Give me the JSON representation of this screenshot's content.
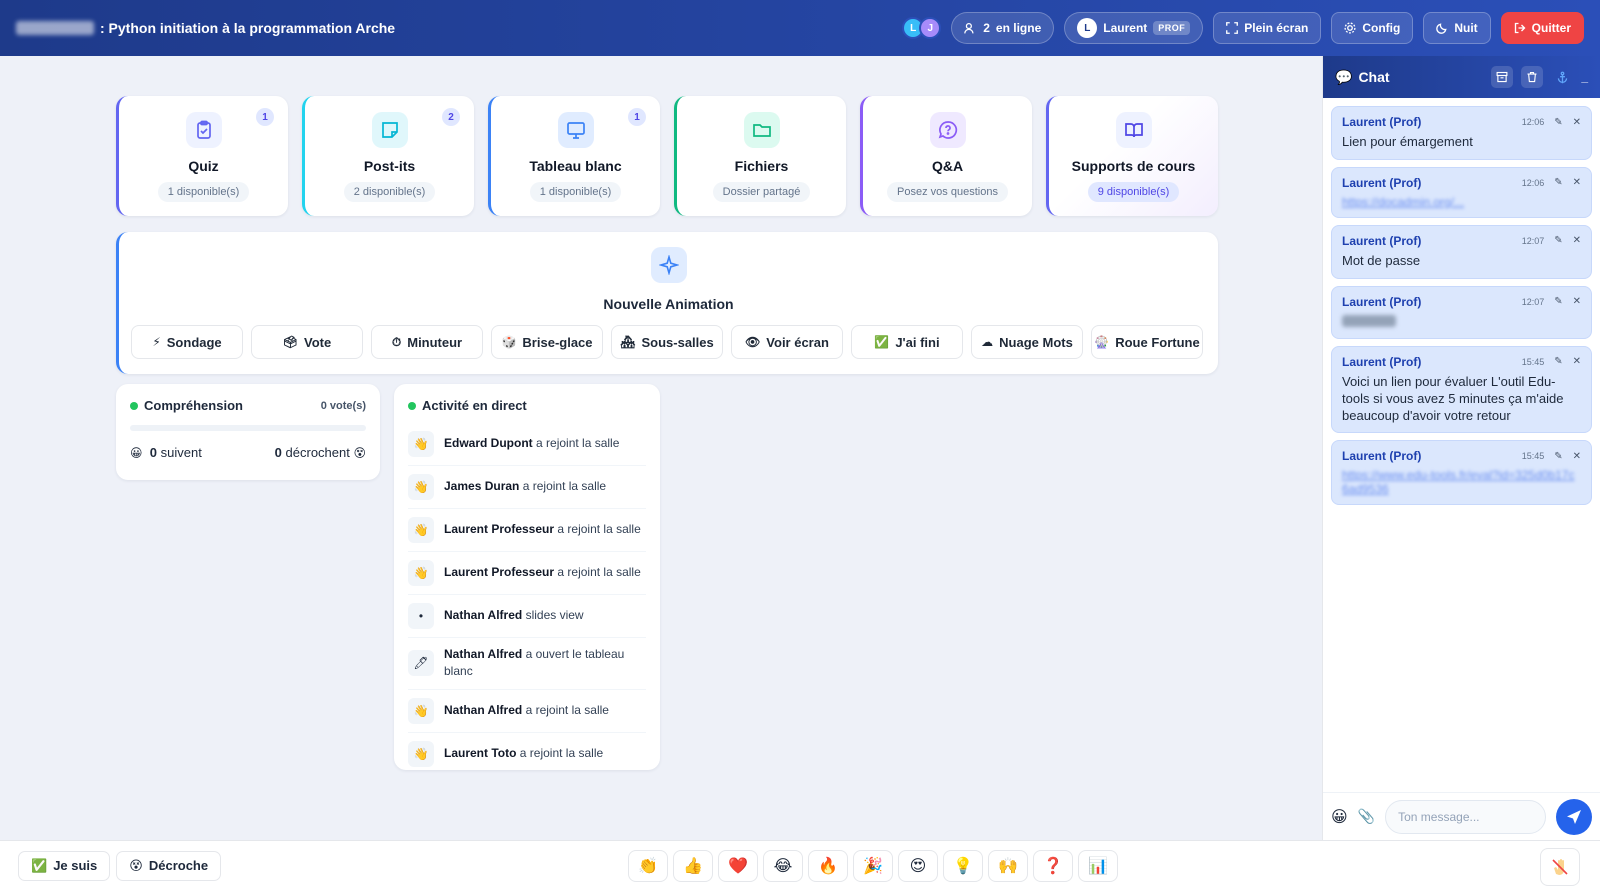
{
  "header": {
    "title": ": Python initiation à la programmation Arche",
    "avatars": [
      "L",
      "J"
    ],
    "online_count": "2",
    "online_label": "en ligne",
    "user_initial": "L",
    "user_name": "Laurent",
    "role_badge": "PROF",
    "fullscreen_label": "Plein écran",
    "config_label": "Config",
    "night_label": "Nuit",
    "quit_label": "Quitter"
  },
  "cards": [
    {
      "title": "Quiz",
      "sub": "1 disponible(s)",
      "count": "1"
    },
    {
      "title": "Post-its",
      "sub": "2 disponible(s)",
      "count": "2"
    },
    {
      "title": "Tableau blanc",
      "sub": "1 disponible(s)",
      "count": "1"
    },
    {
      "title": "Fichiers",
      "sub": "Dossier partagé"
    },
    {
      "title": "Q&A",
      "sub": "Posez vos questions"
    },
    {
      "title": "Supports de cours",
      "sub": "9 disponible(s)"
    }
  ],
  "animation": {
    "title": "Nouvelle Animation",
    "buttons": [
      {
        "icon": "⚡",
        "label": "Sondage"
      },
      {
        "icon": "🗳",
        "label": "Vote"
      },
      {
        "icon": "⏱",
        "label": "Minuteur"
      },
      {
        "icon": "🎲",
        "label": "Brise-glace"
      },
      {
        "icon": "🏘",
        "label": "Sous-salles"
      },
      {
        "icon": "👁",
        "label": "Voir écran"
      },
      {
        "icon": "✅",
        "label": "J'ai fini"
      },
      {
        "icon": "☁",
        "label": "Nuage Mots"
      },
      {
        "icon": "🎡",
        "label": "Roue Fortune"
      }
    ]
  },
  "comprehension": {
    "title": "Compréhension",
    "votes": "0 vote(s)",
    "follow_count": "0",
    "follow_label": "suivent",
    "drop_count": "0",
    "drop_label": "décrochent"
  },
  "activity": {
    "title": "Activité en direct",
    "items": [
      {
        "icon": "👋",
        "name": "Edward Dupont",
        "action": "a rejoint la salle"
      },
      {
        "icon": "👋",
        "name": "James Duran",
        "action": "a rejoint la salle"
      },
      {
        "icon": "👋",
        "name": "Laurent Professeur",
        "action": "a rejoint la salle"
      },
      {
        "icon": "👋",
        "name": "Laurent Professeur",
        "action": "a rejoint la salle"
      },
      {
        "icon": "•",
        "name": "Nathan Alfred",
        "action": "slides view"
      },
      {
        "icon": "🖊",
        "name": "Nathan Alfred",
        "action": "a ouvert le tableau blanc"
      },
      {
        "icon": "👋",
        "name": "Nathan Alfred",
        "action": "a rejoint la salle"
      },
      {
        "icon": "👋",
        "name": "Laurent Toto",
        "action": "a rejoint la salle"
      }
    ]
  },
  "chat": {
    "title": "Chat",
    "input_placeholder": "Ton message...",
    "messages": [
      {
        "author": "Laurent (Prof)",
        "time": "12:06",
        "body": "Lien pour émargement"
      },
      {
        "author": "Laurent (Prof)",
        "time": "12:06",
        "link": "https://docadmin.org/..."
      },
      {
        "author": "Laurent (Prof)",
        "time": "12:07",
        "body": "Mot de passe"
      },
      {
        "author": "Laurent (Prof)",
        "time": "12:07"
      },
      {
        "author": "Laurent (Prof)",
        "time": "15:45",
        "body": "Voici un lien pour évaluer L'outil Edu-tools si vous avez 5 minutes ça m'aide beaucoup d'avoir votre retour"
      },
      {
        "author": "Laurent (Prof)",
        "time": "15:45",
        "link": "https://www.edu-tools.fr/eval?id=325d0b17c6ad9536"
      }
    ]
  },
  "footer": {
    "je_suis_label": "Je suis",
    "decroche_label": "Décroche",
    "reactions": [
      "👏",
      "👍",
      "❤️",
      "😂",
      "🔥",
      "🎉",
      "😍",
      "💡",
      "🙌",
      "❓",
      "📊"
    ]
  },
  "colors": {
    "header_bg": "#1e3a8a",
    "accent": "#2563eb",
    "quit": "#ef4444",
    "online_dot": "#22c55e"
  }
}
